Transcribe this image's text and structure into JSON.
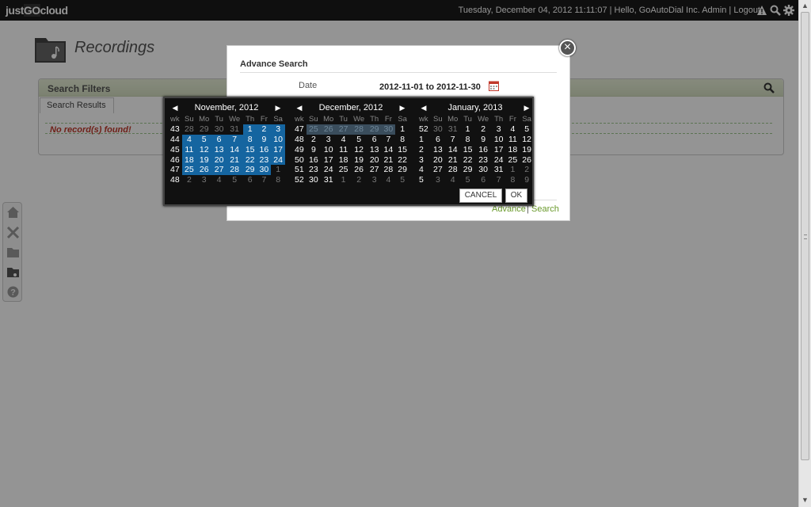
{
  "topbar": {
    "logo_prefix": "just",
    "logo_go": "GO",
    "logo_suffix": "cloud",
    "info": "Tuesday, December 04, 2012 11:11:07 | Hello, GoAutoDial Inc. Admin | Logout",
    "icons": [
      "warning-icon",
      "search-icon",
      "gear-icon"
    ]
  },
  "page": {
    "title": "Recordings",
    "filters_title": "Search Filters",
    "results_tab": "Search Results",
    "no_records": "No record(s) found!"
  },
  "sidenav": [
    "home-icon",
    "tools-icon",
    "folder-icon",
    "recordings-icon",
    "help-icon"
  ],
  "modal": {
    "title": "Advance Search",
    "date_label": "Date",
    "date_value": "2012-11-01 to 2012-11-30",
    "advance_link": "Advance",
    "separator": "|",
    "search_link": "Search"
  },
  "datepicker": {
    "prev_symbol": "◀",
    "next_symbol": "▶",
    "dow": [
      "wk",
      "Su",
      "Mo",
      "Tu",
      "We",
      "Th",
      "Fr",
      "Sa"
    ],
    "cancel": "CANCEL",
    "ok": "OK",
    "months": [
      {
        "title": "November, 2012",
        "weeks": [
          {
            "wk": "43",
            "days": [
              "28",
              "29",
              "30",
              "31",
              "1",
              "2",
              "3"
            ],
            "other": [
              0,
              1,
              2,
              3
            ],
            "sel": [
              4,
              5,
              6
            ]
          },
          {
            "wk": "44",
            "days": [
              "4",
              "5",
              "6",
              "7",
              "8",
              "9",
              "10"
            ],
            "other": [],
            "sel": [
              0,
              1,
              2,
              3,
              4,
              5,
              6
            ]
          },
          {
            "wk": "45",
            "days": [
              "11",
              "12",
              "13",
              "14",
              "15",
              "16",
              "17"
            ],
            "other": [],
            "sel": [
              0,
              1,
              2,
              3,
              4,
              5,
              6
            ]
          },
          {
            "wk": "46",
            "days": [
              "18",
              "19",
              "20",
              "21",
              "22",
              "23",
              "24"
            ],
            "other": [],
            "sel": [
              0,
              1,
              2,
              3,
              4,
              5,
              6
            ]
          },
          {
            "wk": "47",
            "days": [
              "25",
              "26",
              "27",
              "28",
              "29",
              "30",
              "1"
            ],
            "other": [
              6
            ],
            "sel": [
              0,
              1,
              2,
              3,
              4,
              5
            ]
          },
          {
            "wk": "48",
            "days": [
              "2",
              "3",
              "4",
              "5",
              "6",
              "7",
              "8"
            ],
            "other": [
              0,
              1,
              2,
              3,
              4,
              5,
              6
            ],
            "sel": []
          }
        ]
      },
      {
        "title": "December, 2012",
        "weeks": [
          {
            "wk": "47",
            "days": [
              "25",
              "26",
              "27",
              "28",
              "29",
              "30",
              "1"
            ],
            "other": [],
            "sel": [],
            "dim": [
              0,
              1,
              2,
              3,
              4,
              5
            ]
          },
          {
            "wk": "48",
            "days": [
              "2",
              "3",
              "4",
              "5",
              "6",
              "7",
              "8"
            ],
            "other": [],
            "sel": []
          },
          {
            "wk": "49",
            "days": [
              "9",
              "10",
              "11",
              "12",
              "13",
              "14",
              "15"
            ],
            "other": [],
            "sel": []
          },
          {
            "wk": "50",
            "days": [
              "16",
              "17",
              "18",
              "19",
              "20",
              "21",
              "22"
            ],
            "other": [],
            "sel": []
          },
          {
            "wk": "51",
            "days": [
              "23",
              "24",
              "25",
              "26",
              "27",
              "28",
              "29"
            ],
            "other": [],
            "sel": []
          },
          {
            "wk": "52",
            "days": [
              "30",
              "31",
              "1",
              "2",
              "3",
              "4",
              "5"
            ],
            "other": [
              2,
              3,
              4,
              5,
              6
            ],
            "sel": []
          }
        ]
      },
      {
        "title": "January, 2013",
        "weeks": [
          {
            "wk": "52",
            "days": [
              "30",
              "31",
              "1",
              "2",
              "3",
              "4",
              "5"
            ],
            "other": [
              0,
              1
            ],
            "sel": []
          },
          {
            "wk": "1",
            "days": [
              "6",
              "7",
              "8",
              "9",
              "10",
              "11",
              "12"
            ],
            "other": [],
            "sel": []
          },
          {
            "wk": "2",
            "days": [
              "13",
              "14",
              "15",
              "16",
              "17",
              "18",
              "19"
            ],
            "other": [],
            "sel": []
          },
          {
            "wk": "3",
            "days": [
              "20",
              "21",
              "22",
              "23",
              "24",
              "25",
              "26"
            ],
            "other": [],
            "sel": []
          },
          {
            "wk": "4",
            "days": [
              "27",
              "28",
              "29",
              "30",
              "31",
              "1",
              "2"
            ],
            "other": [
              5,
              6
            ],
            "sel": []
          },
          {
            "wk": "5",
            "days": [
              "3",
              "4",
              "5",
              "6",
              "7",
              "8",
              "9"
            ],
            "other": [
              0,
              1,
              2,
              3,
              4,
              5,
              6
            ],
            "sel": []
          }
        ]
      }
    ]
  }
}
